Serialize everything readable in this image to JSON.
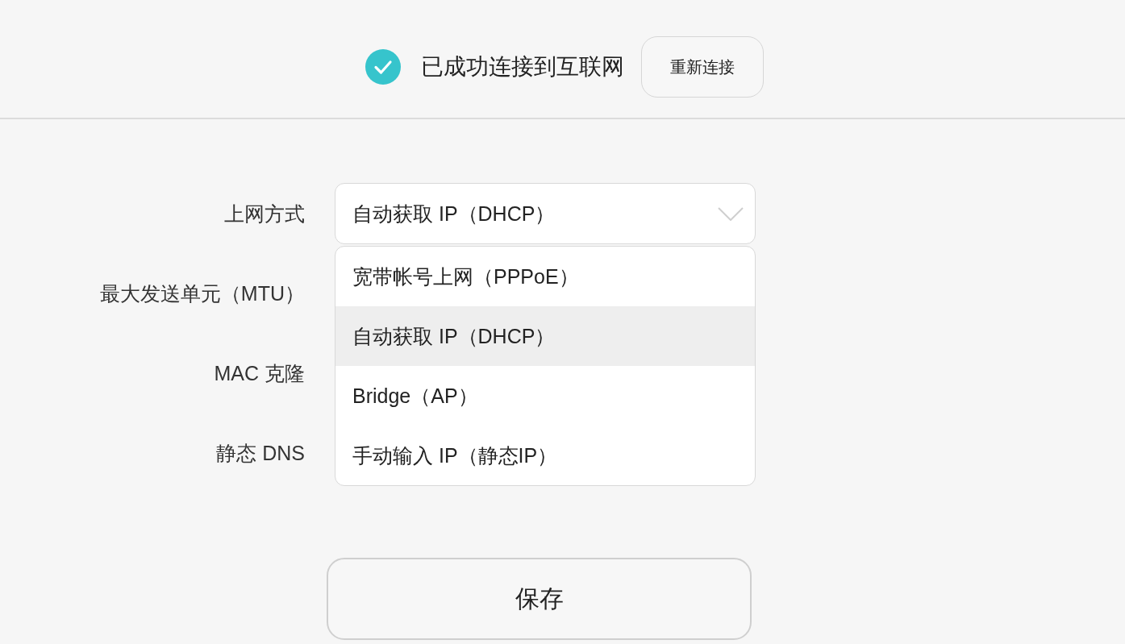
{
  "status": {
    "connected": true,
    "message": "已成功连接到互联网",
    "reconnect_button": "重新连接"
  },
  "form": {
    "rows": [
      {
        "label": "上网方式",
        "select": {
          "value": "自动获取 IP（DHCP）",
          "expanded": true,
          "options": [
            {
              "label": "宽带帐号上网（PPPoE）",
              "selected": false
            },
            {
              "label": "自动获取 IP（DHCP）",
              "selected": true
            },
            {
              "label": "Bridge（AP）",
              "selected": false
            },
            {
              "label": "手动输入 IP（静态IP）",
              "selected": false
            }
          ]
        }
      },
      {
        "label": "最大发送单元（MTU）"
      },
      {
        "label": "MAC 克隆"
      },
      {
        "label": "静态 DNS"
      }
    ]
  },
  "save_button": "保存"
}
